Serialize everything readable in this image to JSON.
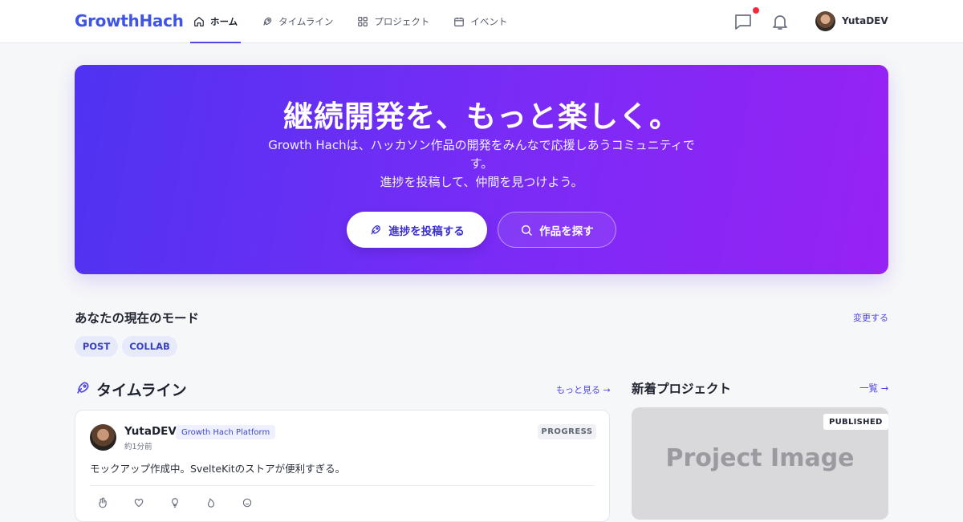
{
  "header": {
    "logo": "GrowthHach",
    "nav": [
      {
        "label": "ホーム",
        "icon": "home-icon",
        "active": true
      },
      {
        "label": "タイムライン",
        "icon": "rocket-icon",
        "active": false
      },
      {
        "label": "プロジェクト",
        "icon": "grid-icon",
        "active": false
      },
      {
        "label": "イベント",
        "icon": "calendar-icon",
        "active": false
      }
    ],
    "user": {
      "name": "YutaDEV"
    },
    "notification_color": "#ef2b3b"
  },
  "hero": {
    "title": "継続開発を、もっと楽しく。",
    "subtitle_line1": "Growth Hachは、ハッカソン作品の開発をみんなで応援しあうコミュニティです。",
    "subtitle_line2": "進捗を投稿して、仲間を見つけよう。",
    "primary_button": "進捗を投稿する",
    "secondary_button": "作品を探す",
    "gradient": [
      "#4f33f2",
      "#9722f4"
    ]
  },
  "mode": {
    "title": "あなたの現在のモード",
    "change_label": "変更する",
    "chips": [
      "POST",
      "COLLAB"
    ]
  },
  "timeline": {
    "title": "タイムライン",
    "more_label": "もっと見る →",
    "posts": [
      {
        "user": "YutaDEV",
        "project": "Growth Hach Platform",
        "time": "約1分前",
        "status": "PROGRESS",
        "body": "モックアップ作成中。SvelteKitのストアが便利すぎる。"
      }
    ]
  },
  "new_projects": {
    "title": "新着プロジェクト",
    "more_label": "一覧 →",
    "items": [
      {
        "image_label": "Project Image",
        "status": "PUBLISHED"
      }
    ]
  },
  "accent_color": "#4f46e5"
}
